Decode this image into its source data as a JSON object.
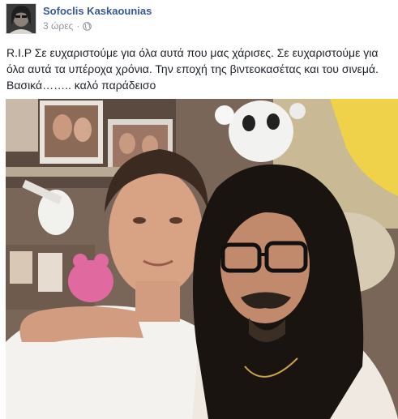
{
  "post": {
    "author_name": "Sofoclis Kaskaounias",
    "timestamp": "3 ώρες",
    "separator": "·",
    "audience_icon": "globe-icon",
    "text": "R.I.P Σε ευχαριστούμε για όλα αυτά που μας χάρισες. Σε ευχαριστούμε για όλα αυτά τα υπέροχα χρόνια. Την εποχή της βιντεοκασέτας και του σινεμά. Βασικά…….. καλό παράδεισο"
  },
  "colors": {
    "author_link": "#365899",
    "meta_gray": "#90949c",
    "body_text": "#1d2129"
  }
}
